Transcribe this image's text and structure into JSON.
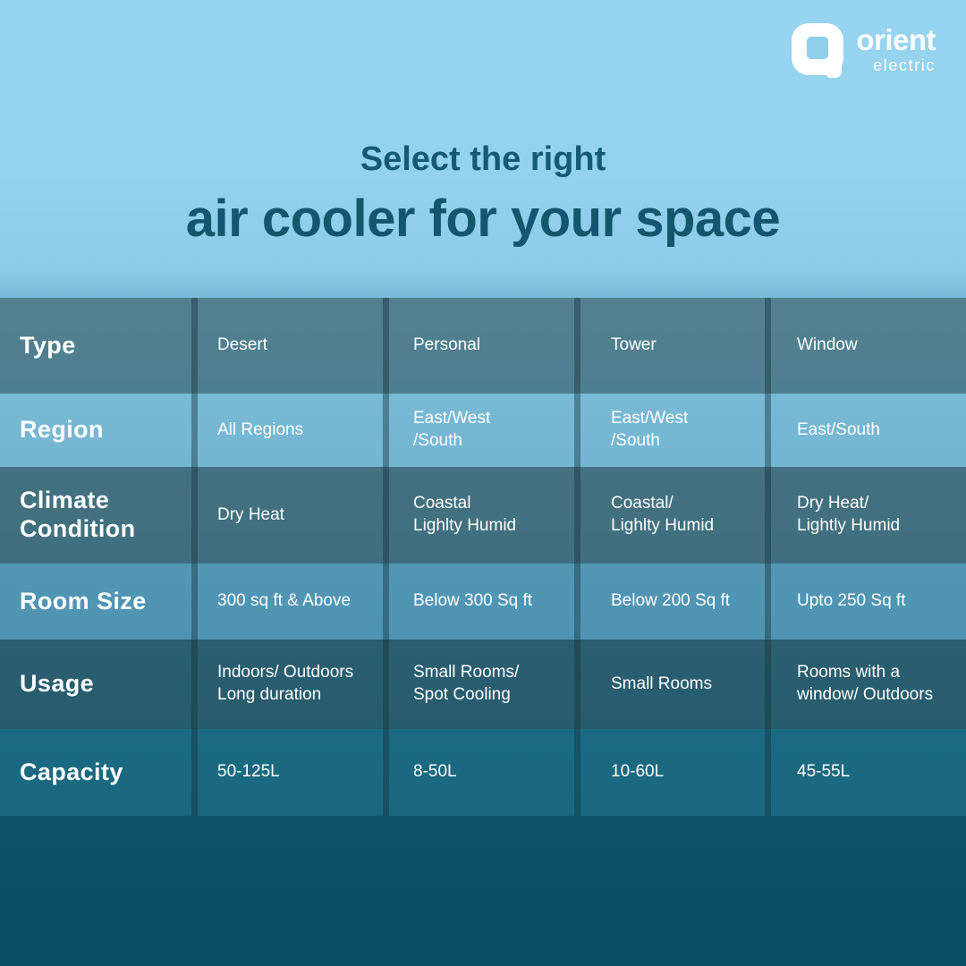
{
  "brand": {
    "logo_icon": "orient-logo-mark",
    "name_primary": "orient",
    "name_secondary": "electric"
  },
  "heading": {
    "line1": "Select the right",
    "line2": "air cooler for your space"
  },
  "colors": {
    "heading": "#14566d",
    "page_top": "#96d4ef",
    "page_bottom": "#0a4f66",
    "row_dark": "#4e7f90",
    "row_light": "#74b6d2",
    "divider": "#17303c",
    "text": "#ffffff"
  },
  "chart_data": {
    "type": "table",
    "title": "Select the right air cooler for your space",
    "columns": [
      "Type",
      "Desert",
      "Personal",
      "Tower",
      "Window"
    ],
    "rows": [
      {
        "label": "Type",
        "values": [
          "Desert",
          "Personal",
          "Tower",
          "Window"
        ]
      },
      {
        "label": "Region",
        "values": [
          "All Regions",
          "East/West\n/South",
          "East/West\n/South",
          "East/South"
        ]
      },
      {
        "label": "Climate\nCondition",
        "values": [
          "Dry Heat",
          "Coastal\nLighlty Humid",
          "Coastal/\nLighlty Humid",
          "Dry Heat/\nLightly Humid"
        ]
      },
      {
        "label": "Room Size",
        "values": [
          "300 sq ft & Above",
          "Below 300 Sq ft",
          "Below 200 Sq ft",
          "Upto 250 Sq ft"
        ]
      },
      {
        "label": "Usage",
        "values": [
          "Indoors/ Outdoors\nLong duration",
          "Small Rooms/\nSpot Cooling",
          "Small Rooms",
          "Rooms with a\nwindow/ Outdoors"
        ]
      },
      {
        "label": "Capacity",
        "values": [
          "50-125L",
          "8-50L",
          "10-60L",
          "45-55L"
        ]
      }
    ]
  }
}
